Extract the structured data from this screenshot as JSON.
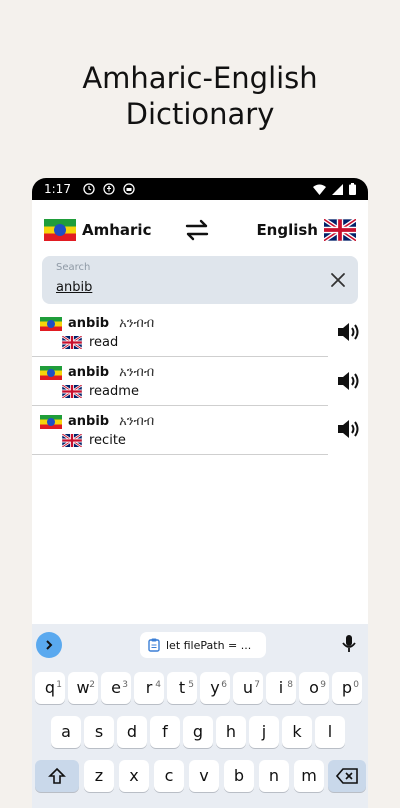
{
  "promo": {
    "title_line1": "Amharic-English",
    "title_line2": "Dictionary"
  },
  "status_bar": {
    "time": "1:17"
  },
  "languages": {
    "source": "Amharic",
    "target": "English"
  },
  "search": {
    "placeholder": "Search",
    "value": "anbib"
  },
  "results": [
    {
      "word": "anbib",
      "amharic": "አንብብ",
      "translation": "read"
    },
    {
      "word": "anbib",
      "amharic": "አንብብ",
      "translation": "readme"
    },
    {
      "word": "anbib",
      "amharic": "አንብብ",
      "translation": "recite"
    }
  ],
  "keyboard": {
    "clipboard_text": "let filePath = ...",
    "row1": [
      {
        "key": "q",
        "hint": "1"
      },
      {
        "key": "w",
        "hint": "2"
      },
      {
        "key": "e",
        "hint": "3"
      },
      {
        "key": "r",
        "hint": "4"
      },
      {
        "key": "t",
        "hint": "5"
      },
      {
        "key": "y",
        "hint": "6"
      },
      {
        "key": "u",
        "hint": "7"
      },
      {
        "key": "i",
        "hint": "8"
      },
      {
        "key": "o",
        "hint": "9"
      },
      {
        "key": "p",
        "hint": "0"
      }
    ],
    "row2": [
      "a",
      "s",
      "d",
      "f",
      "g",
      "h",
      "j",
      "k",
      "l"
    ],
    "row3": [
      "z",
      "x",
      "c",
      "v",
      "b",
      "n",
      "m"
    ]
  },
  "colors": {
    "accent": "#5aa9ef",
    "search_bg": "#dfe5ec",
    "page_bg": "#f4f1ed"
  }
}
